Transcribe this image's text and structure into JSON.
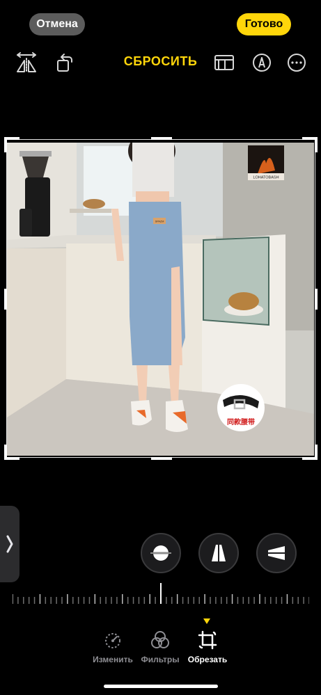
{
  "header": {
    "cancel_label": "Отмена",
    "done_label": "Готово",
    "reset_label": "СБРОСИТЬ"
  },
  "toolbar": {
    "icons": [
      "flip-horizontal-icon",
      "rotate-icon",
      "aspect-ratio-icon",
      "markup-icon",
      "more-icon"
    ]
  },
  "photo": {
    "poster_text": "LOHATOBASH",
    "belt_caption": "同款腰带",
    "jeans_patch": "SPAZM"
  },
  "adjust": {
    "buttons": [
      "straighten-icon",
      "vertical-perspective-icon",
      "horizontal-perspective-icon"
    ],
    "ruler_value": 0
  },
  "tabs": [
    {
      "label": "Изменить",
      "icon": "adjust-dial-icon",
      "active": false
    },
    {
      "label": "Фильтры",
      "icon": "filters-icon",
      "active": false
    },
    {
      "label": "Обрезать",
      "icon": "crop-rotate-icon",
      "active": true
    }
  ],
  "colors": {
    "accent": "#ffd60a",
    "background": "#000000",
    "pill_gray": "#5c5c5c"
  }
}
